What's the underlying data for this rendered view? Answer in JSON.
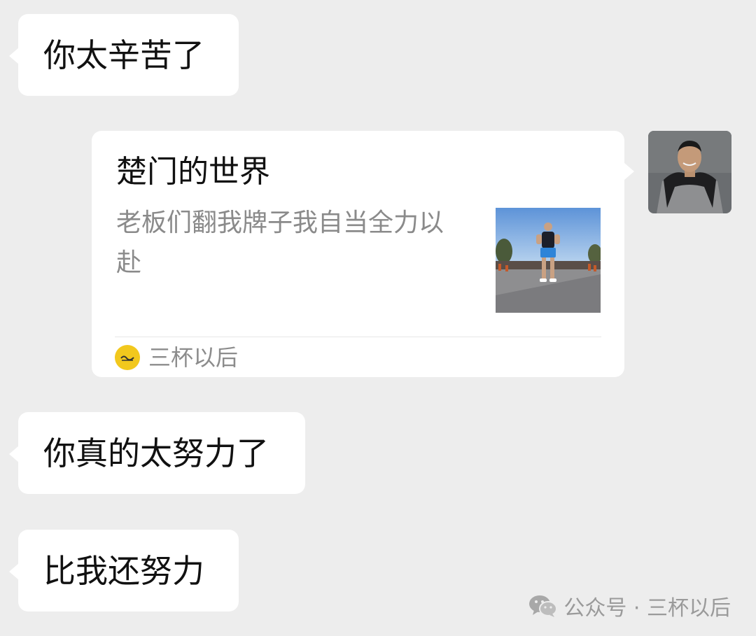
{
  "messages": {
    "msg1": {
      "text": "你太辛苦了"
    },
    "msg3": {
      "text": "你真的太努力了"
    },
    "msg4": {
      "text": "比我还努力"
    }
  },
  "link_card": {
    "title": "楚门的世界",
    "description": "老板们翻我牌子我自当全力以赴",
    "source": "三杯以后",
    "thumbnail_icon": "runner-photo",
    "source_logo_icon": "account-logo-yellow"
  },
  "avatar": {
    "icon": "user-avatar-photo"
  },
  "watermark": {
    "icon": "wechat-icon",
    "text": "公众号 · 三杯以后"
  },
  "colors": {
    "background": "#ededed",
    "bubble": "#ffffff",
    "text_primary": "#111111",
    "text_secondary": "#8a8a8a",
    "source_logo": "#f2c81d"
  }
}
